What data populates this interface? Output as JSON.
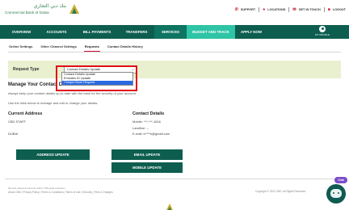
{
  "header": {
    "logo_arabic": "بنك دبي التجاري",
    "logo_english": "Commercial Bank of Dubai",
    "links": {
      "support": "SUPPORT",
      "locations": "LOCATIONS",
      "get_in_touch": "GET IN TOUCH",
      "logout": "LOGOUT"
    }
  },
  "nav": {
    "items": [
      {
        "label": "OVERVIEW"
      },
      {
        "label": "ACCOUNTS"
      },
      {
        "label": "BILL PAYMENTS"
      },
      {
        "label": "TRANSFERS"
      },
      {
        "label": "SERVICES"
      },
      {
        "label": "BUDGET AND TRACK"
      },
      {
        "label": "APPLY NOW"
      }
    ],
    "profile_label": "MY PROFILE"
  },
  "subtabs": [
    {
      "label": "Online Settings"
    },
    {
      "label": "Other Channel Settings"
    },
    {
      "label": "Requests"
    },
    {
      "label": "Contact Details History"
    }
  ],
  "request": {
    "label": "Request Type",
    "selected": "Contact Details Update",
    "options": [
      "Contact Details Update",
      "Emirates ID Update",
      "Cheque Book Request"
    ]
  },
  "content": {
    "heading": "Manage Your Contact Details",
    "intro": "Always keep your contact details up-to-date with the bank for the security of your account.",
    "links_text": "Use the links below to manage and edit or change your details."
  },
  "address": {
    "heading": "Current Address",
    "line1": "CBD STAFF",
    "line2": "DUBAI"
  },
  "contact": {
    "heading": "Contact Details",
    "mobile": "Mobile: ***-***-1616",
    "landline": "Landline: --",
    "email": "E-mail: b****s@gmail.com"
  },
  "buttons": {
    "address_update": "ADDRESS UPDATE",
    "email_update": "EMAIL UPDATE",
    "mobile_update": "MOBILE UPDATE"
  },
  "footer": {
    "line1": "We best viewed at minimum 1024 x 768 pixels resolution",
    "line2": "About CBD | Privacy Policy | Terms & Conditions | Terms of Use | Security | Fees & Charges",
    "copyright": "Copyright © 2024 CBD. All Rights Reserved."
  },
  "chat": {
    "badge": "Chat"
  },
  "colors": {
    "nav_bg": "#0d5e4f",
    "nav_highlight": "#2ec4a6",
    "accent_red": "#c8102e",
    "request_band": "#e8f0d0",
    "dropdown_selected": "#2a6ae0"
  },
  "icons": {
    "support": "phone-icon",
    "locations": "pin-icon",
    "get_in_touch": "mail-icon",
    "logout": "lock-icon",
    "profile": "user-icon",
    "chat": "chat-bot-icon"
  }
}
